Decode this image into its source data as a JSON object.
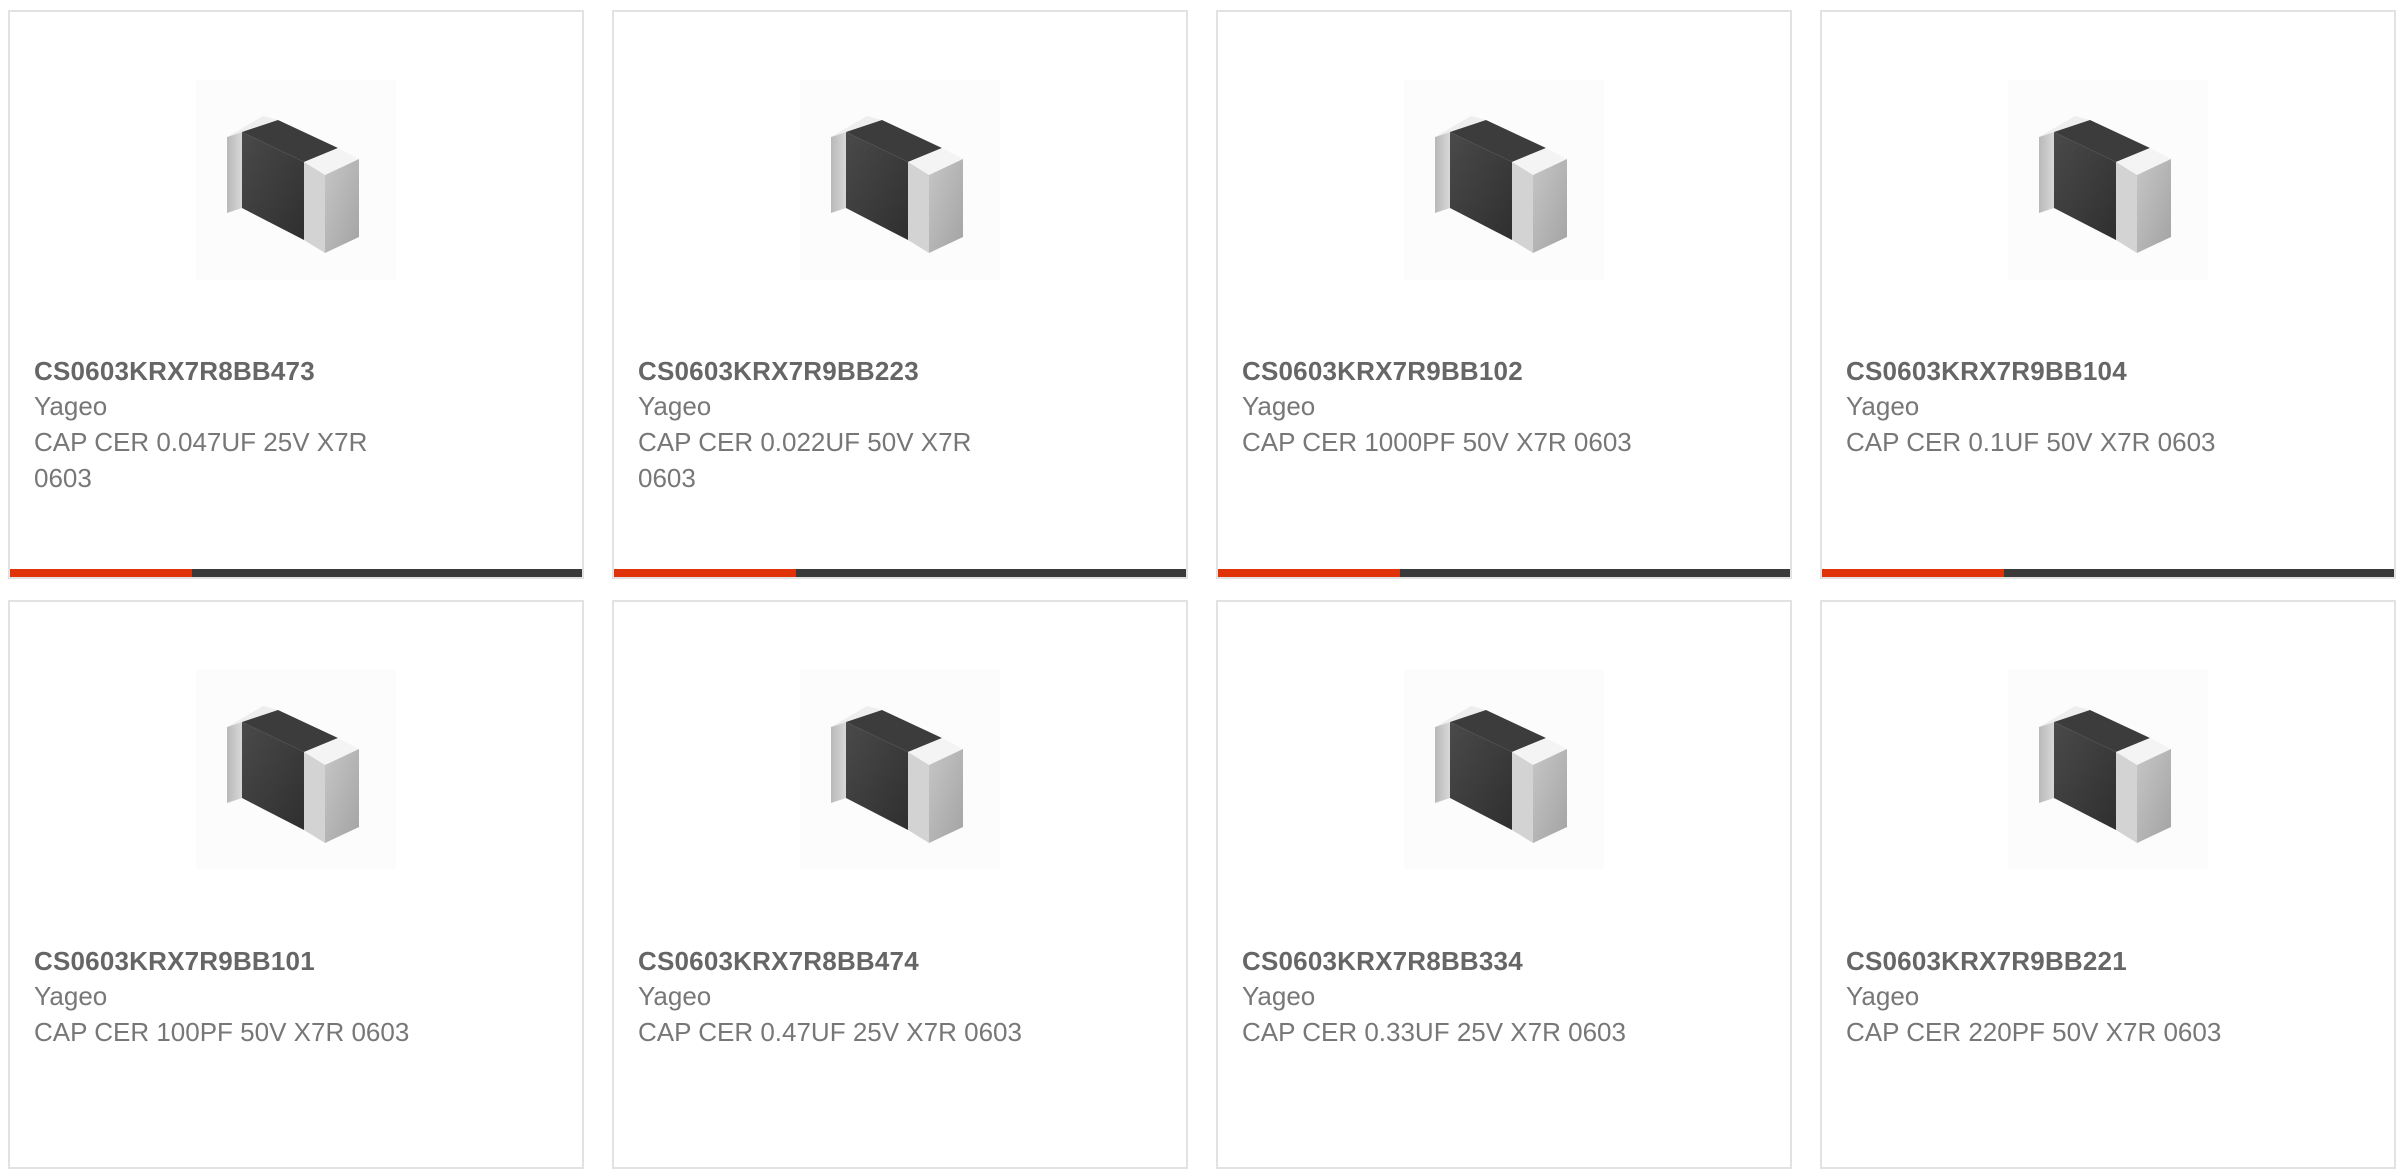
{
  "products": [
    {
      "part_number": "CS0603KRX7R8BB473",
      "manufacturer": "Yageo",
      "description": "CAP CER 0.047UF 25V X7R 0603"
    },
    {
      "part_number": "CS0603KRX7R9BB223",
      "manufacturer": "Yageo",
      "description": "CAP CER 0.022UF 50V X7R 0603"
    },
    {
      "part_number": "CS0603KRX7R9BB102",
      "manufacturer": "Yageo",
      "description": "CAP CER 1000PF 50V X7R 0603"
    },
    {
      "part_number": "CS0603KRX7R9BB104",
      "manufacturer": "Yageo",
      "description": "CAP CER 0.1UF 50V X7R 0603"
    },
    {
      "part_number": "CS0603KRX7R9BB101",
      "manufacturer": "Yageo",
      "description": "CAP CER 100PF 50V X7R 0603"
    },
    {
      "part_number": "CS0603KRX7R8BB474",
      "manufacturer": "Yageo",
      "description": "CAP CER 0.47UF 25V X7R 0603"
    },
    {
      "part_number": "CS0603KRX7R8BB334",
      "manufacturer": "Yageo",
      "description": "CAP CER 0.33UF 25V X7R 0603"
    },
    {
      "part_number": "CS0603KRX7R9BB221",
      "manufacturer": "Yageo",
      "description": "CAP CER 220PF 50V X7R 0603"
    }
  ],
  "product_image_icon": "smd-capacitor-icon",
  "colors": {
    "accent": "#e0330a",
    "bar": "#3a3a3a",
    "border": "#e2e2e2",
    "text": "#666666"
  }
}
